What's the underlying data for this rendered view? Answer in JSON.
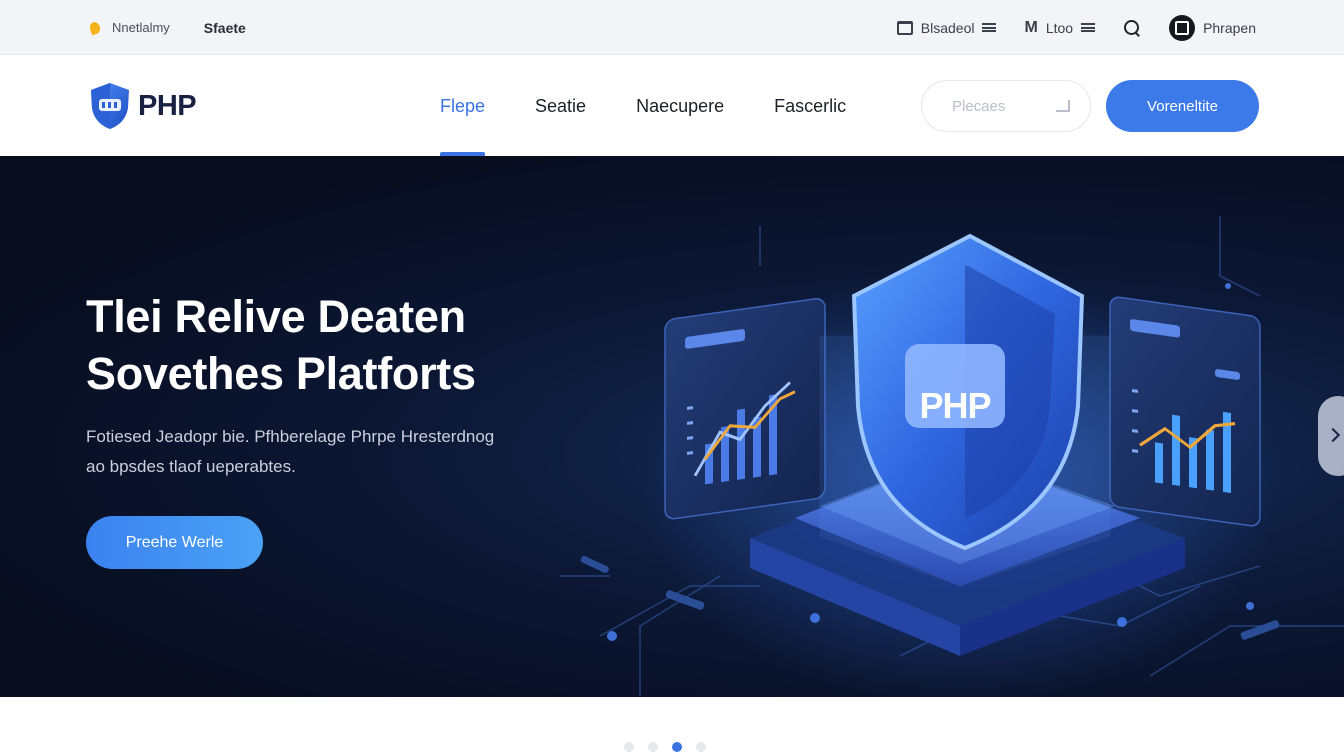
{
  "topbar": {
    "left_items": [
      {
        "label": "Nnetlalmy",
        "icon": "spark-icon"
      },
      {
        "label": "Sfaete"
      }
    ],
    "right_items": [
      {
        "label": "Blsadeol",
        "icon": "bank-icon"
      },
      {
        "label": "Ltoo",
        "icon": "m-logo-icon"
      }
    ],
    "user_label": "Phrapen"
  },
  "header": {
    "logo_text": "PHP",
    "nav": [
      "Flepe",
      "Seatie",
      "Naecupere",
      "Fascerlic"
    ],
    "active_nav_index": 0,
    "search_placeholder": "Plecaes",
    "cta_label": "Voreneltite"
  },
  "hero": {
    "title_line1": "Tlei Relive Deaten",
    "title_line2": "Sovethes Platforts",
    "subtitle_line1": "Fotiesed Jeadopr bie. Pfhberelage Phrpe Hresterdnog",
    "subtitle_line2": "ao bpsdes tlaof ueperabtes.",
    "cta_label": "Preehe Werle",
    "shield_badge": "PHP"
  },
  "carousel": {
    "count": 4,
    "active_index": 2
  },
  "colors": {
    "accent": "#3b7ae8",
    "hero_bg": "#0c1836",
    "logo_dark": "#1a2244"
  }
}
